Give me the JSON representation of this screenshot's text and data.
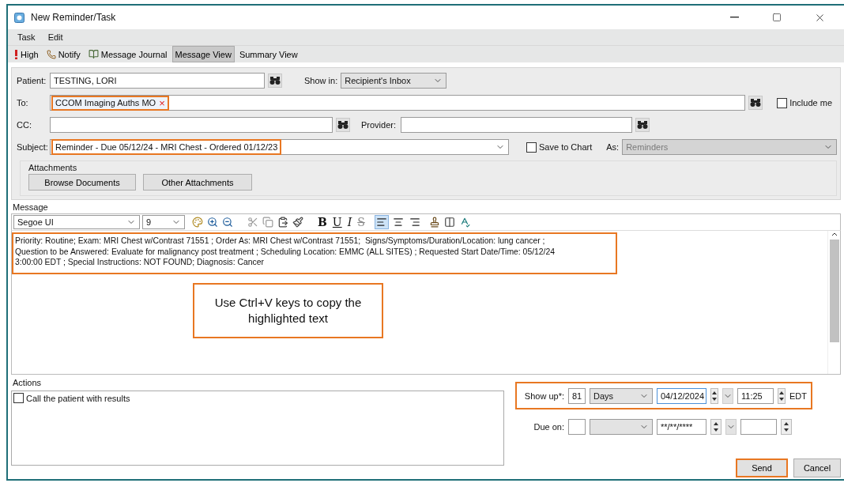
{
  "window": {
    "title": "New Reminder/Task"
  },
  "menu": [
    {
      "label": "Task"
    },
    {
      "label": "Edit"
    }
  ],
  "toolbar": [
    {
      "label": "High",
      "kind": "priority",
      "selected": false
    },
    {
      "label": "Notify",
      "kind": "phone",
      "selected": false
    },
    {
      "label": "Message Journal",
      "kind": "journal",
      "selected": false
    },
    {
      "label": "Message View",
      "kind": "text",
      "selected": true
    },
    {
      "label": "Summary View",
      "kind": "text",
      "selected": false
    }
  ],
  "patient": {
    "label": "Patient:",
    "value": "TESTING, LORI"
  },
  "show_in": {
    "label": "Show in:",
    "value": "Recipient's Inbox"
  },
  "to": {
    "label": "To:",
    "recipient": "CCOM Imaging Auths MO",
    "remove": "×",
    "highlighted": true
  },
  "include_me": {
    "label": "Include me",
    "checked": false
  },
  "cc": {
    "label": "CC:"
  },
  "provider": {
    "label": "Provider:"
  },
  "subject": {
    "label": "Subject:",
    "value": "Reminder - Due 05/12/24 - MRI Chest - Ordered 01/12/23",
    "highlighted": true
  },
  "save_to_chart": {
    "label": "Save to Chart",
    "checked": false
  },
  "as": {
    "label": "As:",
    "value": "Reminders",
    "disabled": true
  },
  "attachments": {
    "title": "Attachments",
    "buttons": [
      "Browse Documents",
      "Other Attachments"
    ]
  },
  "message": {
    "label": "Message",
    "font": "Segoe UI",
    "size": "9",
    "format": [
      {
        "label": "B",
        "kind": "bold"
      },
      {
        "label": "U",
        "kind": "underline"
      },
      {
        "label": "I",
        "kind": "italic"
      },
      {
        "label": "S",
        "kind": "strike"
      }
    ],
    "align": [
      {
        "kind": "left",
        "selected": true
      },
      {
        "kind": "center",
        "selected": false
      },
      {
        "kind": "right",
        "selected": false
      }
    ],
    "lines": [
      "Priority: Routine; Exam: MRI Chest w/Contrast 71551 ; Order As: MRI Chest w/Contrast 71551;  Signs/Symptoms/Duration/Location: lung cancer ;",
      "Question to be Answered: Evaluate for malignancy post treatment ; Scheduling Location: EMMC (ALL SITES) ; Requested Start Date/Time: 05/12/24",
      "3:00:00 EDT ; Special Instructions: NOT FOUND; Diagnosis: Cancer"
    ],
    "highlighted": true
  },
  "callout": "Use Ctrl+V keys to copy the highlighted text",
  "actions": {
    "label": "Actions",
    "items": [
      {
        "label": "Call the patient with results",
        "checked": false
      }
    ]
  },
  "show_up": {
    "label": "Show up*:",
    "count": "81",
    "unit": "Days",
    "date": "04/12/2024",
    "time": "11:25",
    "zone": "EDT",
    "highlighted": true
  },
  "due_on": {
    "label": "Due on:",
    "date": "**/**/****"
  },
  "buttons": [
    {
      "label": "Send",
      "highlighted": true
    },
    {
      "label": "Cancel",
      "highlighted": false
    }
  ]
}
